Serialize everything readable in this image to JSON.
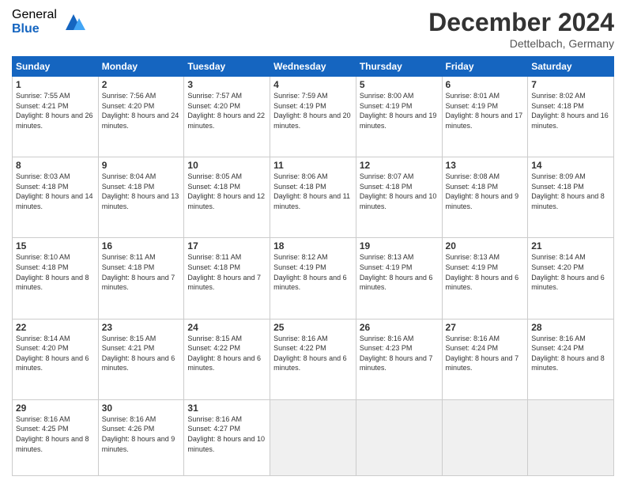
{
  "logo": {
    "general": "General",
    "blue": "Blue"
  },
  "header": {
    "month": "December 2024",
    "location": "Dettelbach, Germany"
  },
  "weekdays": [
    "Sunday",
    "Monday",
    "Tuesday",
    "Wednesday",
    "Thursday",
    "Friday",
    "Saturday"
  ],
  "weeks": [
    [
      {
        "day": "1",
        "sunrise": "7:55 AM",
        "sunset": "4:21 PM",
        "daylight": "8 hours and 26 minutes."
      },
      {
        "day": "2",
        "sunrise": "7:56 AM",
        "sunset": "4:20 PM",
        "daylight": "8 hours and 24 minutes."
      },
      {
        "day": "3",
        "sunrise": "7:57 AM",
        "sunset": "4:20 PM",
        "daylight": "8 hours and 22 minutes."
      },
      {
        "day": "4",
        "sunrise": "7:59 AM",
        "sunset": "4:19 PM",
        "daylight": "8 hours and 20 minutes."
      },
      {
        "day": "5",
        "sunrise": "8:00 AM",
        "sunset": "4:19 PM",
        "daylight": "8 hours and 19 minutes."
      },
      {
        "day": "6",
        "sunrise": "8:01 AM",
        "sunset": "4:19 PM",
        "daylight": "8 hours and 17 minutes."
      },
      {
        "day": "7",
        "sunrise": "8:02 AM",
        "sunset": "4:18 PM",
        "daylight": "8 hours and 16 minutes."
      }
    ],
    [
      {
        "day": "8",
        "sunrise": "8:03 AM",
        "sunset": "4:18 PM",
        "daylight": "8 hours and 14 minutes."
      },
      {
        "day": "9",
        "sunrise": "8:04 AM",
        "sunset": "4:18 PM",
        "daylight": "8 hours and 13 minutes."
      },
      {
        "day": "10",
        "sunrise": "8:05 AM",
        "sunset": "4:18 PM",
        "daylight": "8 hours and 12 minutes."
      },
      {
        "day": "11",
        "sunrise": "8:06 AM",
        "sunset": "4:18 PM",
        "daylight": "8 hours and 11 minutes."
      },
      {
        "day": "12",
        "sunrise": "8:07 AM",
        "sunset": "4:18 PM",
        "daylight": "8 hours and 10 minutes."
      },
      {
        "day": "13",
        "sunrise": "8:08 AM",
        "sunset": "4:18 PM",
        "daylight": "8 hours and 9 minutes."
      },
      {
        "day": "14",
        "sunrise": "8:09 AM",
        "sunset": "4:18 PM",
        "daylight": "8 hours and 8 minutes."
      }
    ],
    [
      {
        "day": "15",
        "sunrise": "8:10 AM",
        "sunset": "4:18 PM",
        "daylight": "8 hours and 8 minutes."
      },
      {
        "day": "16",
        "sunrise": "8:11 AM",
        "sunset": "4:18 PM",
        "daylight": "8 hours and 7 minutes."
      },
      {
        "day": "17",
        "sunrise": "8:11 AM",
        "sunset": "4:18 PM",
        "daylight": "8 hours and 7 minutes."
      },
      {
        "day": "18",
        "sunrise": "8:12 AM",
        "sunset": "4:19 PM",
        "daylight": "8 hours and 6 minutes."
      },
      {
        "day": "19",
        "sunrise": "8:13 AM",
        "sunset": "4:19 PM",
        "daylight": "8 hours and 6 minutes."
      },
      {
        "day": "20",
        "sunrise": "8:13 AM",
        "sunset": "4:19 PM",
        "daylight": "8 hours and 6 minutes."
      },
      {
        "day": "21",
        "sunrise": "8:14 AM",
        "sunset": "4:20 PM",
        "daylight": "8 hours and 6 minutes."
      }
    ],
    [
      {
        "day": "22",
        "sunrise": "8:14 AM",
        "sunset": "4:20 PM",
        "daylight": "8 hours and 6 minutes."
      },
      {
        "day": "23",
        "sunrise": "8:15 AM",
        "sunset": "4:21 PM",
        "daylight": "8 hours and 6 minutes."
      },
      {
        "day": "24",
        "sunrise": "8:15 AM",
        "sunset": "4:22 PM",
        "daylight": "8 hours and 6 minutes."
      },
      {
        "day": "25",
        "sunrise": "8:16 AM",
        "sunset": "4:22 PM",
        "daylight": "8 hours and 6 minutes."
      },
      {
        "day": "26",
        "sunrise": "8:16 AM",
        "sunset": "4:23 PM",
        "daylight": "8 hours and 7 minutes."
      },
      {
        "day": "27",
        "sunrise": "8:16 AM",
        "sunset": "4:24 PM",
        "daylight": "8 hours and 7 minutes."
      },
      {
        "day": "28",
        "sunrise": "8:16 AM",
        "sunset": "4:24 PM",
        "daylight": "8 hours and 8 minutes."
      }
    ],
    [
      {
        "day": "29",
        "sunrise": "8:16 AM",
        "sunset": "4:25 PM",
        "daylight": "8 hours and 8 minutes."
      },
      {
        "day": "30",
        "sunrise": "8:16 AM",
        "sunset": "4:26 PM",
        "daylight": "8 hours and 9 minutes."
      },
      {
        "day": "31",
        "sunrise": "8:16 AM",
        "sunset": "4:27 PM",
        "daylight": "8 hours and 10 minutes."
      },
      null,
      null,
      null,
      null
    ]
  ]
}
